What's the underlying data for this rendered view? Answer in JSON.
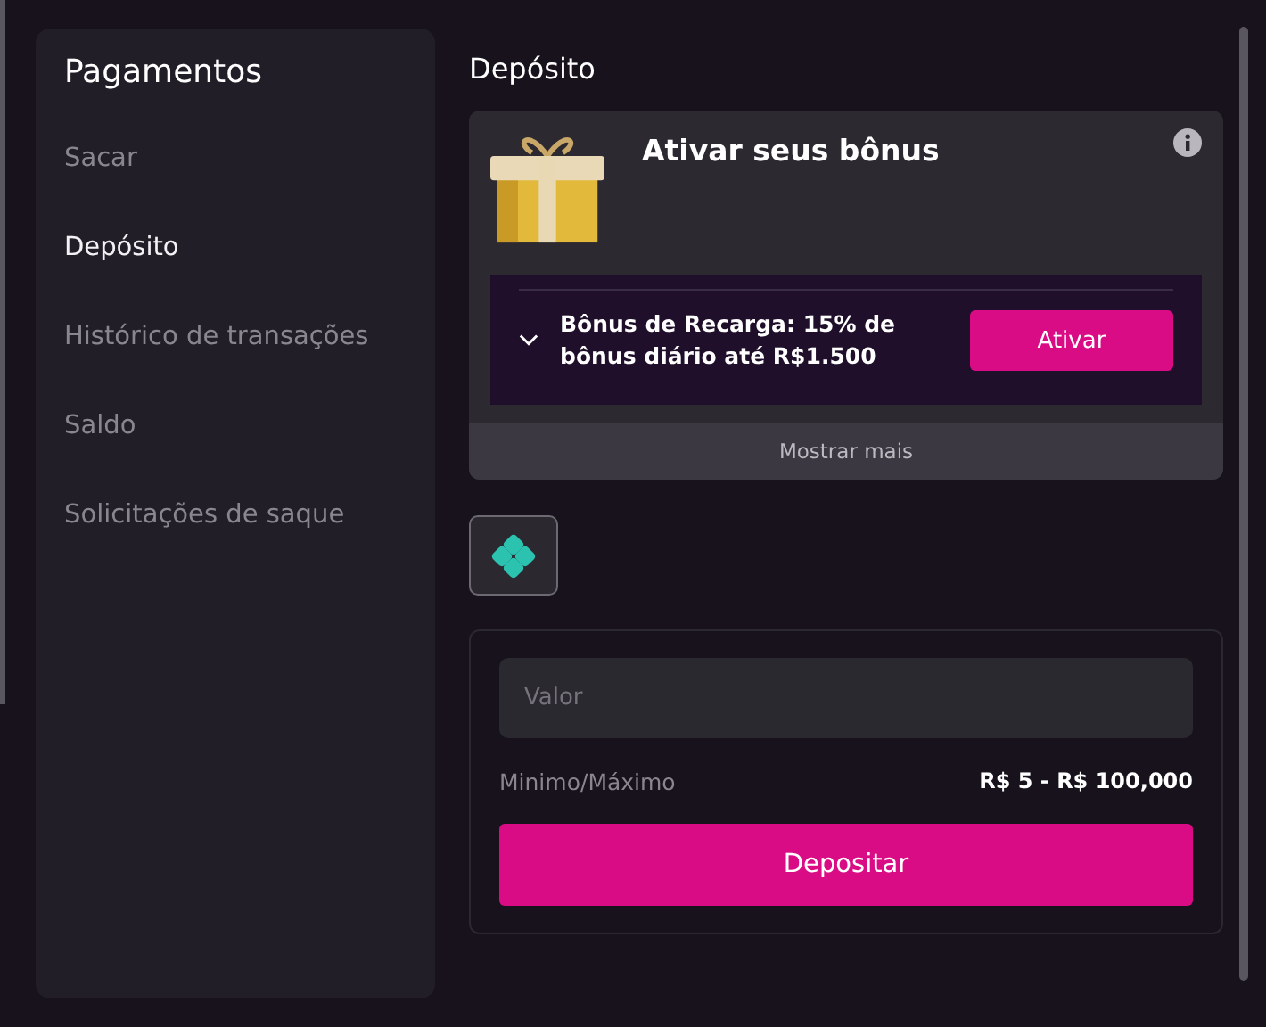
{
  "sidebar": {
    "title": "Pagamentos",
    "items": [
      {
        "label": "Sacar",
        "selected": false
      },
      {
        "label": "Depósito",
        "selected": true
      },
      {
        "label": "Histórico de transações",
        "selected": false
      },
      {
        "label": "Saldo",
        "selected": false
      },
      {
        "label": "Solicitações de saque",
        "selected": false
      }
    ]
  },
  "main": {
    "title": "Depósito",
    "bonus": {
      "title": "Ativar seus bônus",
      "offer": {
        "text": "Bônus de Recarga: 15% de bônus diário até R$1.500",
        "expanded": false,
        "button": "Ativar"
      },
      "show_more": "Mostrar mais"
    },
    "payment_methods": [
      {
        "selected": true
      }
    ],
    "form": {
      "placeholder": "Valor",
      "limit_label": "Minimo/Máximo",
      "limit_value": "R$ 5 - R$ 100,000",
      "submit": "Depositar"
    }
  }
}
